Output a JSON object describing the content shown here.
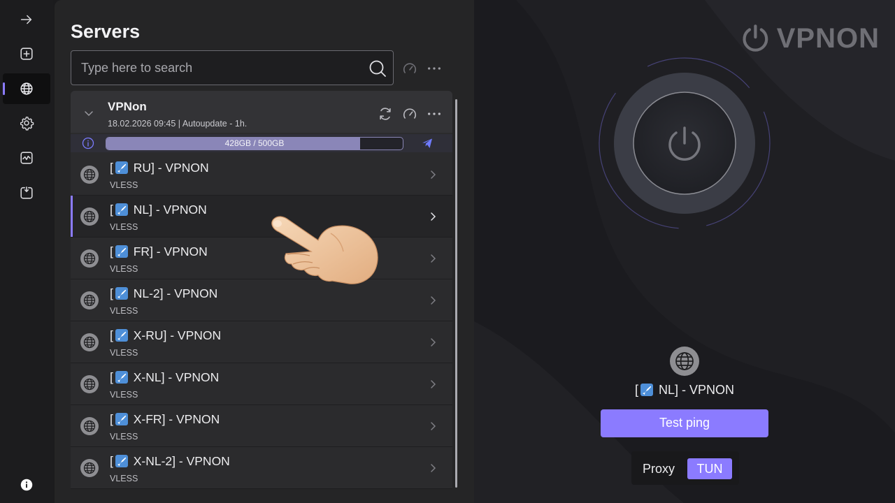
{
  "rail": {
    "items": [
      {
        "icon": "arrow-right-icon"
      },
      {
        "icon": "plus-square-icon"
      },
      {
        "icon": "globe-icon",
        "active": true
      },
      {
        "icon": "gear-icon"
      },
      {
        "icon": "activity-chart-icon"
      },
      {
        "icon": "import-box-icon"
      },
      {
        "icon": "info-icon"
      }
    ]
  },
  "servers": {
    "title": "Servers",
    "search_placeholder": "Type here to search",
    "group": {
      "name": "VPNon",
      "meta": "18.02.2026 09:45 | Autoupdate - 1h.",
      "usage_label": "428GB / 500GB",
      "usage_fraction": 0.856
    },
    "items": [
      {
        "pre": "[",
        "post": " RU] - VPNON",
        "protocol": "VLESS"
      },
      {
        "pre": "[",
        "post": " NL] - VPNON",
        "protocol": "VLESS",
        "selected": true
      },
      {
        "pre": "[",
        "post": " FR] - VPNON",
        "protocol": "VLESS"
      },
      {
        "pre": "[",
        "post": " NL-2] - VPNON",
        "protocol": "VLESS"
      },
      {
        "pre": "[",
        "post": " X-RU] - VPNON",
        "protocol": "VLESS"
      },
      {
        "pre": "[",
        "post": " X-NL] - VPNON",
        "protocol": "VLESS"
      },
      {
        "pre": "[",
        "post": " X-FR] - VPNON",
        "protocol": "VLESS"
      },
      {
        "pre": "[",
        "post": " X-NL-2] - VPNON",
        "protocol": "VLESS"
      }
    ]
  },
  "main": {
    "logo_text": "VPNON",
    "selected": {
      "pre": "[",
      "post": " NL] - VPNON"
    },
    "ping_label": "Test ping",
    "mode_proxy": "Proxy",
    "mode_tun": "TUN",
    "active_mode": "TUN"
  },
  "colors": {
    "accent": "#8b7bff",
    "panel": "#252526",
    "background": "#1f1f23"
  }
}
